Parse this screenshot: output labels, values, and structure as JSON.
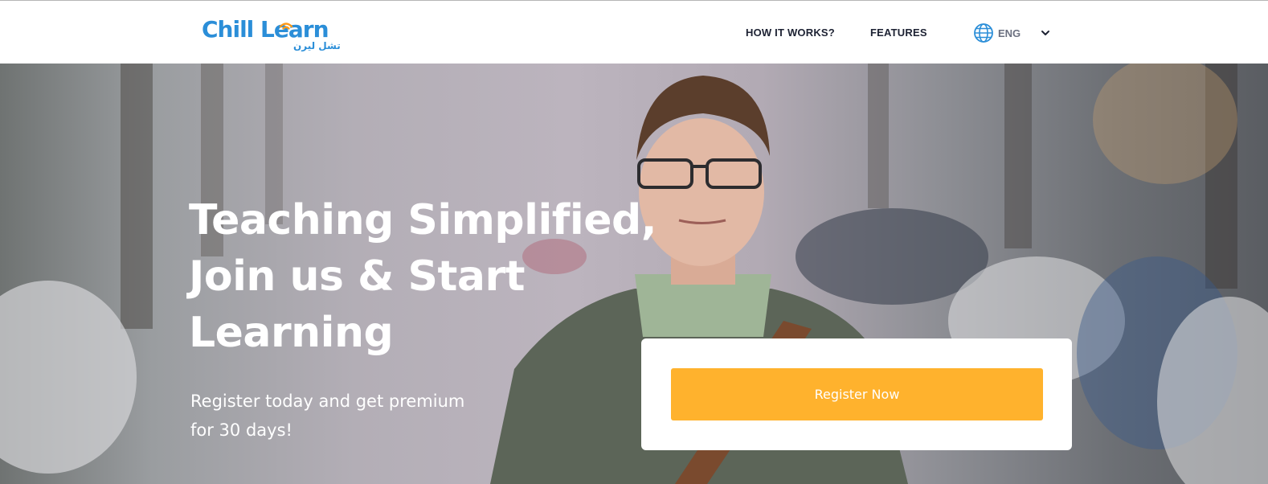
{
  "brand": {
    "name_part1": "Chill Le",
    "name_part2": "rn",
    "arabic_name": "تشل ليرن",
    "color": "#2b8ed8",
    "accent": "#ff9a1a"
  },
  "nav": {
    "how_it_works": "HOW IT WORKS?",
    "features": "FEATURES",
    "language": "ENG",
    "language_icon": "globe-icon",
    "dropdown_icon": "chevron-down-icon"
  },
  "hero": {
    "title_lines": [
      "Teaching Simplified,",
      "Join us & Start",
      "Learning"
    ],
    "subtitle_lines": [
      "Register today and get premium",
      "for 30 days!"
    ],
    "cta_label": "Register Now",
    "cta_color": "#ffb22d"
  }
}
